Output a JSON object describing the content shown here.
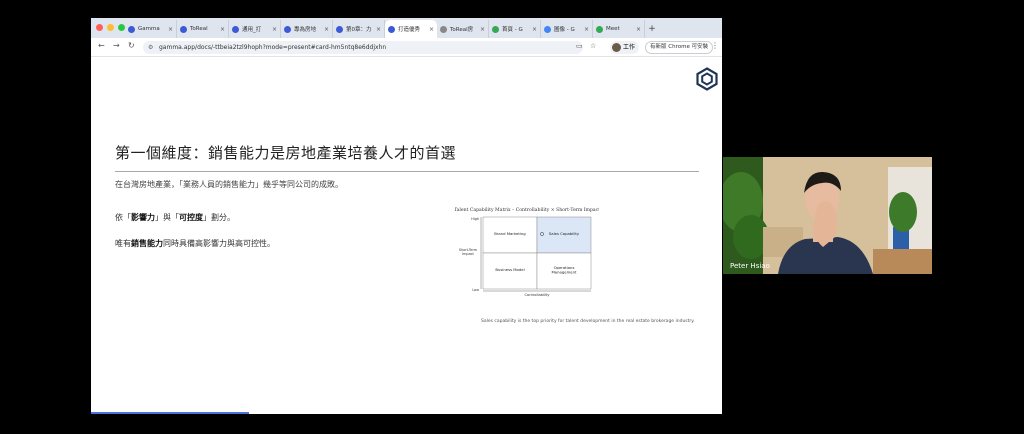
{
  "browser": {
    "tabs": [
      {
        "title": "Gamma",
        "favicon": "#3b5bd6",
        "active": false
      },
      {
        "title": "ToReal",
        "favicon": "#3b5bd6",
        "active": false
      },
      {
        "title": "通用_打",
        "favicon": "#3b5bd6",
        "active": false
      },
      {
        "title": "專為房地",
        "favicon": "#3b5bd6",
        "active": false
      },
      {
        "title": "第0章：力",
        "favicon": "#3b5bd6",
        "active": false
      },
      {
        "title": "打造優秀",
        "favicon": "#3b5bd6",
        "active": true
      },
      {
        "title": "ToReal房",
        "favicon": "#888888",
        "active": false
      },
      {
        "title": "首頁 - G",
        "favicon": "#34a853",
        "active": false
      },
      {
        "title": "圖像 - G",
        "favicon": "#4285f4",
        "active": false
      },
      {
        "title": "Meet",
        "favicon": "#34a853",
        "active": false
      }
    ],
    "new_tab": "+",
    "url": "gamma.app/docs/-ttbeia2tzl9hoph?mode=present#card-hm5ntq8e6ddjxhn",
    "profile_label": "工作",
    "update_label": "有新版 Chrome 可安裝"
  },
  "slide": {
    "title": "第一個維度：銷售能力是房地產業培養人才的首選",
    "subtitle": "在台灣房地產業，「業務人員的銷售能力」幾乎等同公司的成敗。",
    "para1": {
      "before": "依「",
      "b1": "影響力",
      "mid": "」與「",
      "b2": "可控度",
      "after": "」劃分。"
    },
    "para2": {
      "b": "銷售能力",
      "before": "唯有",
      "after": "同時具備高影響力與高可控性。"
    },
    "caption": "Sales capability is the top priority for talent development in the real estate brokerage industry.",
    "progress_fraction": 0.25
  },
  "chart_data": {
    "type": "matrix",
    "title": "Talent Capability Matrix – Controllability × Short-Term Impact",
    "xlabel": "Controllability",
    "ylabel": "Short-Term Impact",
    "y_ticks": [
      "High",
      "Low"
    ],
    "cells": [
      {
        "row": 0,
        "col": 0,
        "label": "Brand Marketing",
        "highlight": false
      },
      {
        "row": 0,
        "col": 1,
        "label": "Sales Capability",
        "highlight": true
      },
      {
        "row": 1,
        "col": 0,
        "label": "Business Model",
        "highlight": false
      },
      {
        "row": 1,
        "col": 1,
        "label": "Operations Management",
        "highlight": false
      }
    ],
    "highlight_color": "#dbe6f6"
  },
  "video": {
    "participant_name": "Peter Hsiao"
  }
}
